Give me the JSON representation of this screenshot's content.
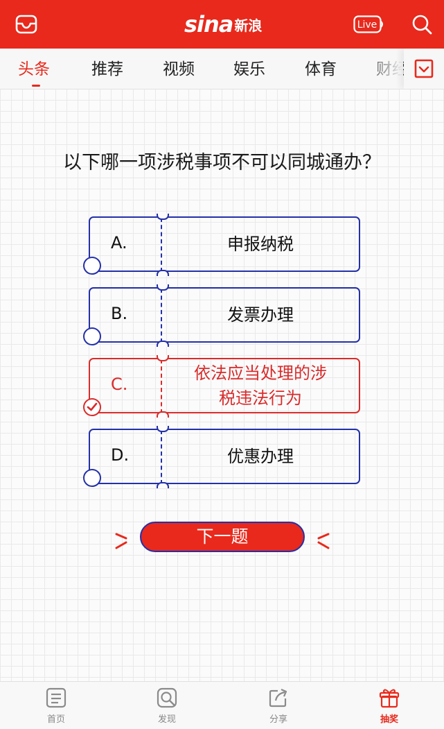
{
  "header": {
    "logo_text": "sina",
    "logo_cn": "新浪",
    "live_label": "Live",
    "brand_color": "#e8291c",
    "icons": [
      "inbox-icon",
      "live-icon",
      "search-icon"
    ]
  },
  "tabs": [
    {
      "label": "头条",
      "active": true
    },
    {
      "label": "推荐",
      "active": false
    },
    {
      "label": "视频",
      "active": false
    },
    {
      "label": "娱乐",
      "active": false
    },
    {
      "label": "体育",
      "active": false
    },
    {
      "label": "财经",
      "active": false
    }
  ],
  "quiz": {
    "question": "以下哪一项涉税事项不可以同城通办？",
    "options": [
      {
        "letter": "A.",
        "text": "申报纳税",
        "selected": false
      },
      {
        "letter": "B.",
        "text": "发票办理",
        "selected": false
      },
      {
        "letter": "C.",
        "text": "依法应当处理的涉税违法行为",
        "selected": true
      },
      {
        "letter": "D.",
        "text": "优惠办理",
        "selected": false
      }
    ],
    "next_button": "下一题",
    "frame_color": "#2430a8",
    "selected_color": "#d92b2b"
  },
  "bottom_nav": [
    {
      "label": "首页",
      "icon": "home-icon",
      "active": false
    },
    {
      "label": "发现",
      "icon": "discover-icon",
      "active": false
    },
    {
      "label": "分享",
      "icon": "share-icon",
      "active": false
    },
    {
      "label": "抽奖",
      "icon": "gift-icon",
      "active": true
    }
  ]
}
